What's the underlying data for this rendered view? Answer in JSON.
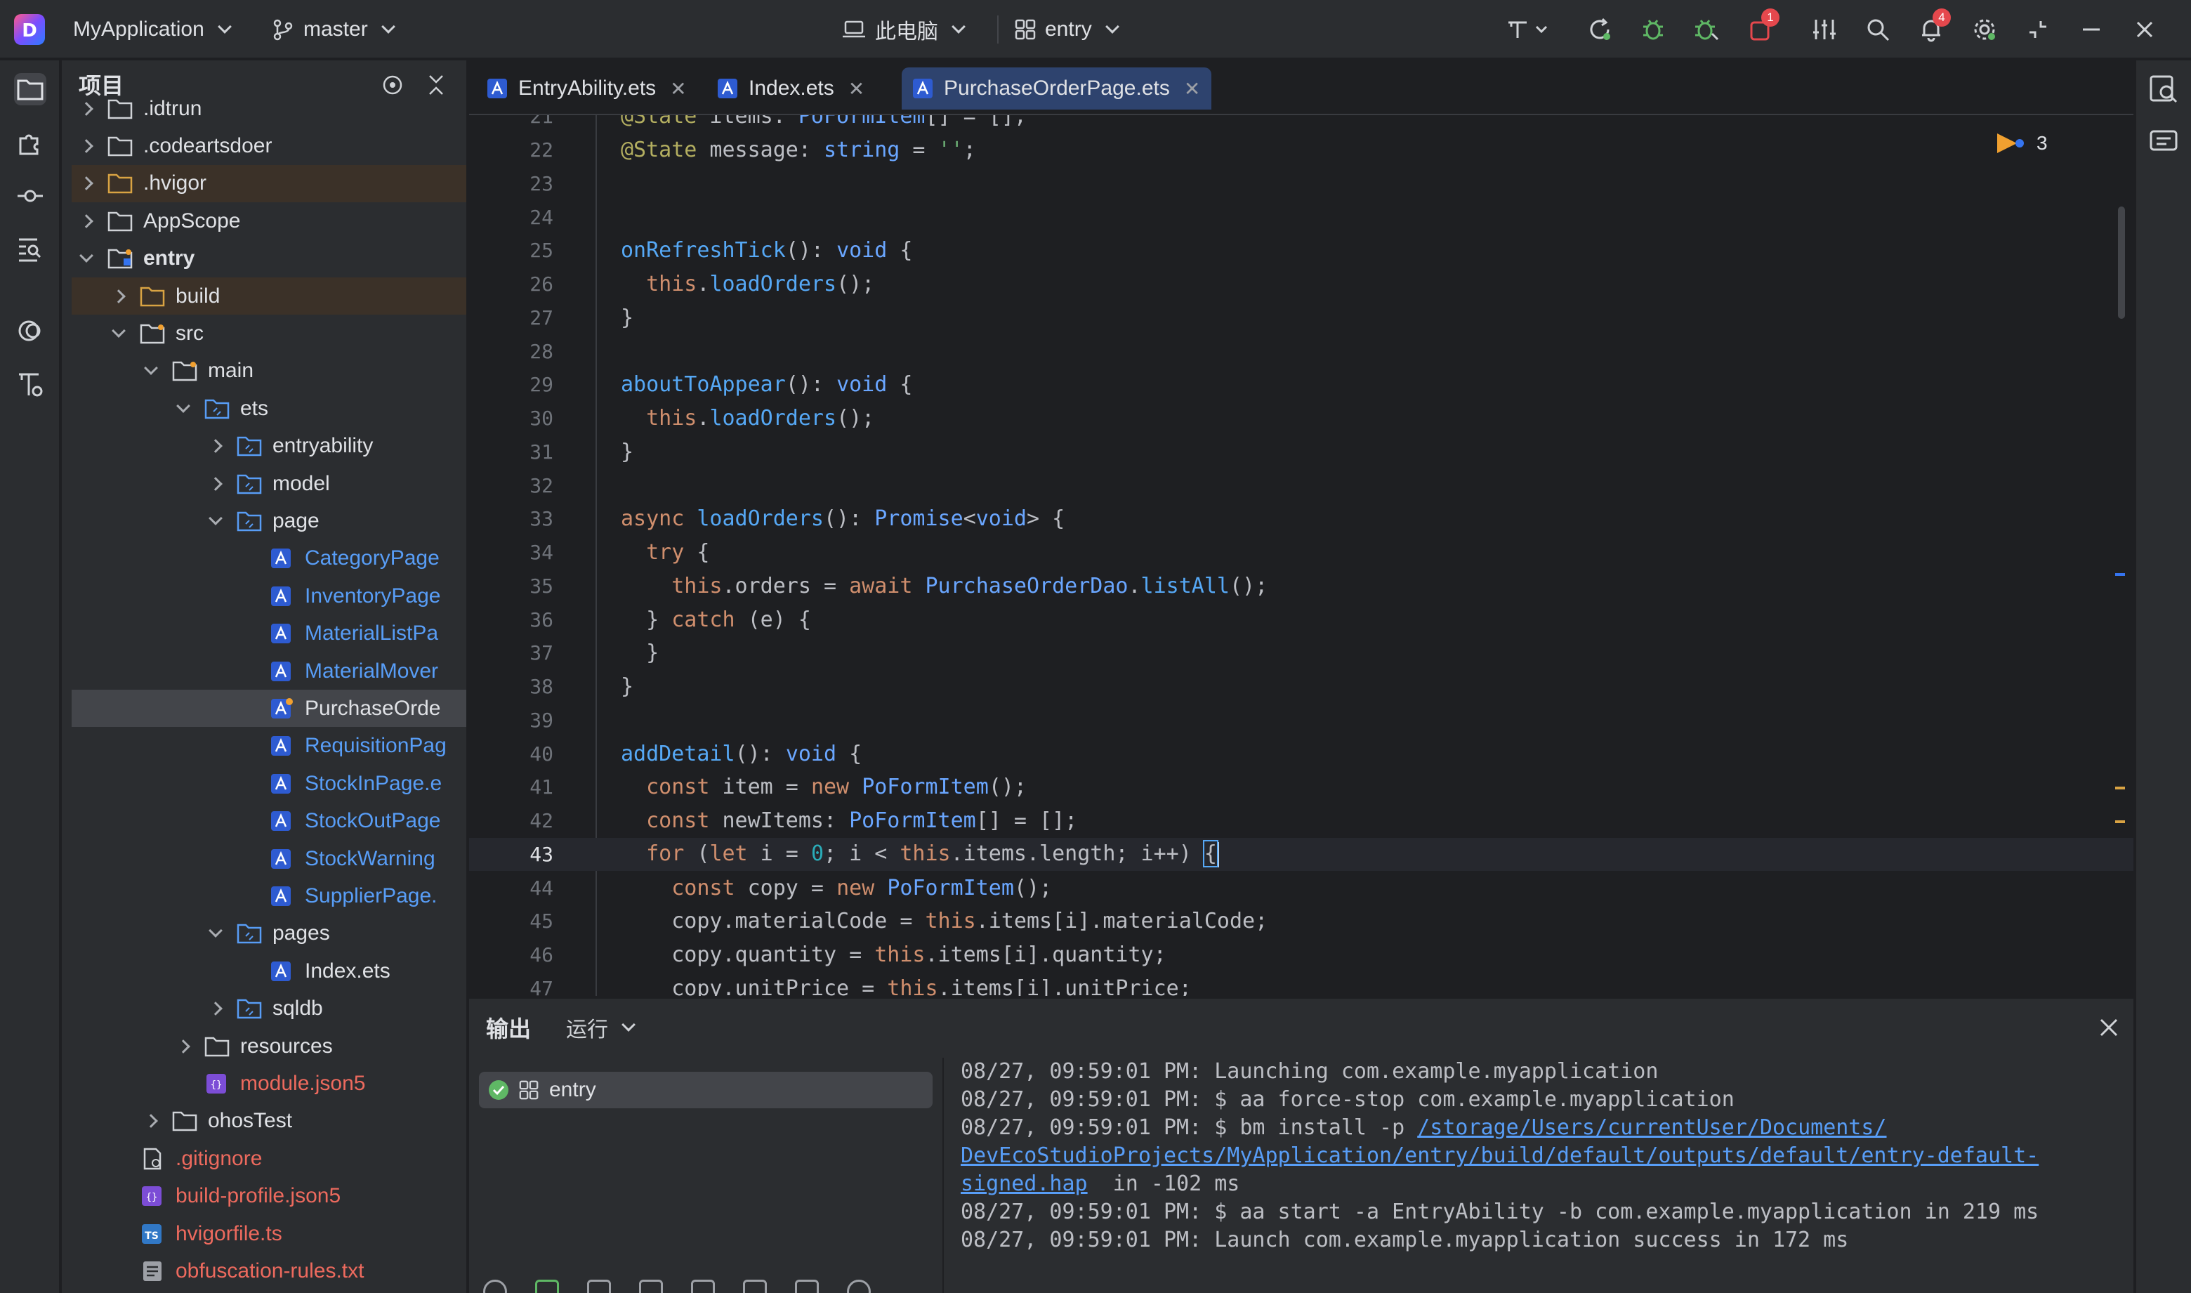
{
  "titlebar": {
    "app_name": "MyApplication",
    "branch": "master",
    "device": "此电脑",
    "module": "entry",
    "notification_count": "4",
    "problem_count": "1"
  },
  "project_panel": {
    "title": "项目",
    "items": [
      {
        "label": ".idtrun",
        "indent": 1,
        "type": "folder",
        "arrow": "closed",
        "color": "normal"
      },
      {
        "label": ".codeartsdoer",
        "indent": 1,
        "type": "folder",
        "arrow": "closed",
        "color": "normal"
      },
      {
        "label": ".hvigor",
        "indent": 1,
        "type": "folder-orange",
        "arrow": "closed",
        "color": "normal",
        "state": "hl"
      },
      {
        "label": "AppScope",
        "indent": 1,
        "type": "folder",
        "arrow": "closed",
        "color": "normal"
      },
      {
        "label": "entry",
        "indent": 1,
        "type": "module",
        "arrow": "open",
        "color": "bold"
      },
      {
        "label": "build",
        "indent": 2,
        "type": "folder-orange",
        "arrow": "closed",
        "color": "normal",
        "state": "hl"
      },
      {
        "label": "src",
        "indent": 2,
        "type": "folder-src",
        "arrow": "open",
        "color": "normal"
      },
      {
        "label": "main",
        "indent": 3,
        "type": "folder-src",
        "arrow": "open",
        "color": "normal"
      },
      {
        "label": "ets",
        "indent": 4,
        "type": "folder-ets",
        "arrow": "open",
        "color": "normal"
      },
      {
        "label": "entryability",
        "indent": 5,
        "type": "folder-ets",
        "arrow": "closed",
        "color": "normal"
      },
      {
        "label": "model",
        "indent": 5,
        "type": "folder-ets",
        "arrow": "closed",
        "color": "normal"
      },
      {
        "label": "page",
        "indent": 5,
        "type": "folder-ets",
        "arrow": "open",
        "color": "normal"
      },
      {
        "label": "CategoryPage",
        "indent": 6,
        "type": "ets",
        "arrow": "none",
        "color": "blue"
      },
      {
        "label": "InventoryPage",
        "indent": 6,
        "type": "ets",
        "arrow": "none",
        "color": "blue"
      },
      {
        "label": "MaterialListPa",
        "indent": 6,
        "type": "ets",
        "arrow": "none",
        "color": "blue"
      },
      {
        "label": "MaterialMover",
        "indent": 6,
        "type": "ets",
        "arrow": "none",
        "color": "blue"
      },
      {
        "label": "PurchaseOrde",
        "indent": 6,
        "type": "ets-mod",
        "arrow": "none",
        "color": "normal",
        "state": "sel"
      },
      {
        "label": "RequisitionPag",
        "indent": 6,
        "type": "ets",
        "arrow": "none",
        "color": "blue"
      },
      {
        "label": "StockInPage.e",
        "indent": 6,
        "type": "ets",
        "arrow": "none",
        "color": "blue"
      },
      {
        "label": "StockOutPage",
        "indent": 6,
        "type": "ets",
        "arrow": "none",
        "color": "blue"
      },
      {
        "label": "StockWarning",
        "indent": 6,
        "type": "ets",
        "arrow": "none",
        "color": "blue"
      },
      {
        "label": "SupplierPage.",
        "indent": 6,
        "type": "ets",
        "arrow": "none",
        "color": "blue"
      },
      {
        "label": "pages",
        "indent": 5,
        "type": "folder-ets",
        "arrow": "open",
        "color": "normal"
      },
      {
        "label": "Index.ets",
        "indent": 6,
        "type": "ets",
        "arrow": "none",
        "color": "normal"
      },
      {
        "label": "sqldb",
        "indent": 5,
        "type": "folder-ets",
        "arrow": "closed",
        "color": "normal"
      },
      {
        "label": "resources",
        "indent": 4,
        "type": "folder",
        "arrow": "closed",
        "color": "normal"
      },
      {
        "label": "module.json5",
        "indent": 4,
        "type": "json",
        "arrow": "none",
        "color": "red"
      },
      {
        "label": "ohosTest",
        "indent": 3,
        "type": "folder",
        "arrow": "closed",
        "color": "normal"
      },
      {
        "label": ".gitignore",
        "indent": 2,
        "type": "gitignore",
        "arrow": "none",
        "color": "red"
      },
      {
        "label": "build-profile.json5",
        "indent": 2,
        "type": "json",
        "arrow": "none",
        "color": "red"
      },
      {
        "label": "hvigorfile.ts",
        "indent": 2,
        "type": "ts",
        "arrow": "none",
        "color": "red"
      },
      {
        "label": "obfuscation-rules.txt",
        "indent": 2,
        "type": "txt",
        "arrow": "none",
        "color": "red"
      }
    ]
  },
  "tabs": [
    {
      "label": "EntryAbility.ets",
      "active": false
    },
    {
      "label": "Index.ets",
      "active": false
    },
    {
      "label": "PurchaseOrderPage.ets",
      "active": true
    }
  ],
  "editor": {
    "inspection_count": "3",
    "current_line": "43",
    "lines": [
      {
        "n": "21",
        "html": "<span class='ann'>@State</span> items: <span class='ty'>PoFormItem</span>[] = [];"
      },
      {
        "n": "22",
        "html": "<span class='ann'>@State</span> message: <span class='ty'>string</span> = <span class='str'>''</span>;"
      },
      {
        "n": "23",
        "html": ""
      },
      {
        "n": "24",
        "html": ""
      },
      {
        "n": "25",
        "html": "<span class='fn'>onRefreshTick</span>(): <span class='ty'>void</span> {"
      },
      {
        "n": "26",
        "html": "  <span class='kw'>this</span>.<span class='fn'>loadOrders</span>();"
      },
      {
        "n": "27",
        "html": "}"
      },
      {
        "n": "28",
        "html": ""
      },
      {
        "n": "29",
        "html": "<span class='fn'>aboutToAppear</span>(): <span class='ty'>void</span> {"
      },
      {
        "n": "30",
        "html": "  <span class='kw'>this</span>.<span class='fn'>loadOrders</span>();"
      },
      {
        "n": "31",
        "html": "}"
      },
      {
        "n": "32",
        "html": ""
      },
      {
        "n": "33",
        "html": "<span class='kw'>async</span> <span class='fn'>loadOrders</span>(): <span class='ty'>Promise</span>&lt;<span class='ty'>void</span>&gt; {"
      },
      {
        "n": "34",
        "html": "  <span class='kw'>try</span> {"
      },
      {
        "n": "35",
        "html": "    <span class='kw'>this</span>.orders = <span class='kw'>await</span> <span class='ty'>PurchaseOrderDao</span>.<span class='fn'>listAll</span>();"
      },
      {
        "n": "36",
        "html": "  } <span class='kw'>catch</span> (e) {"
      },
      {
        "n": "37",
        "html": "  }"
      },
      {
        "n": "38",
        "html": "}"
      },
      {
        "n": "39",
        "html": ""
      },
      {
        "n": "40",
        "html": "<span class='fn'>addDetail</span>(): <span class='ty'>void</span> {"
      },
      {
        "n": "41",
        "html": "  <span class='kw'>const</span> item = <span class='kw'>new</span> <span class='ty'>PoFormItem</span>();"
      },
      {
        "n": "42",
        "html": "  <span class='kw'>const</span> newItems: <span class='ty'>PoFormItem</span>[] = [];"
      },
      {
        "n": "43",
        "html": "  <span class='kw'>for</span> (<span class='kw'>let</span> i = <span class='num'>0</span>; i &lt; <span class='kw'>this</span>.items.length; i++) <span class='bracket-hl'>{</span><span class='caret'></span>"
      },
      {
        "n": "44",
        "html": "    <span class='kw'>const</span> copy = <span class='kw'>new</span> <span class='ty'>PoFormItem</span>();"
      },
      {
        "n": "45",
        "html": "    copy.materialCode = <span class='kw'>this</span>.items[i].materialCode;"
      },
      {
        "n": "46",
        "html": "    copy.quantity = <span class='kw'>this</span>.items[i].quantity;"
      },
      {
        "n": "47",
        "html": "    copy.unitPrice = <span class='kw'>this</span>.items[i].unitPrice;"
      }
    ]
  },
  "output": {
    "title": "输出",
    "run_tab": "运行",
    "entry_label": "entry",
    "log": [
      {
        "text": "08/27, 09:59:01 PM: Launching com.example.myapplication",
        "link": ""
      },
      {
        "text": "08/27, 09:59:01 PM: $ aa force-stop com.example.myapplication",
        "link": ""
      },
      {
        "text": "08/27, 09:59:01 PM: $ bm install -p ",
        "link": "/storage/Users/currentUser/Documents/"
      },
      {
        "text": "",
        "link": "DevEcoStudioProjects/MyApplication/entry/build/default/outputs/default/entry-default-"
      },
      {
        "text": "",
        "link": "signed.hap",
        "suffix": "  in -102 ms"
      },
      {
        "text": "08/27, 09:59:01 PM: $ aa start -a EntryAbility -b com.example.myapplication in 219 ms",
        "link": ""
      },
      {
        "text": "08/27, 09:59:01 PM: Launch com.example.myapplication success in 172 ms",
        "link": ""
      }
    ]
  },
  "colors": {
    "accent": "#3574f0",
    "orange_folder": "#d9a343",
    "file_blue": "#589df6",
    "file_red": "#ed6a5e"
  }
}
